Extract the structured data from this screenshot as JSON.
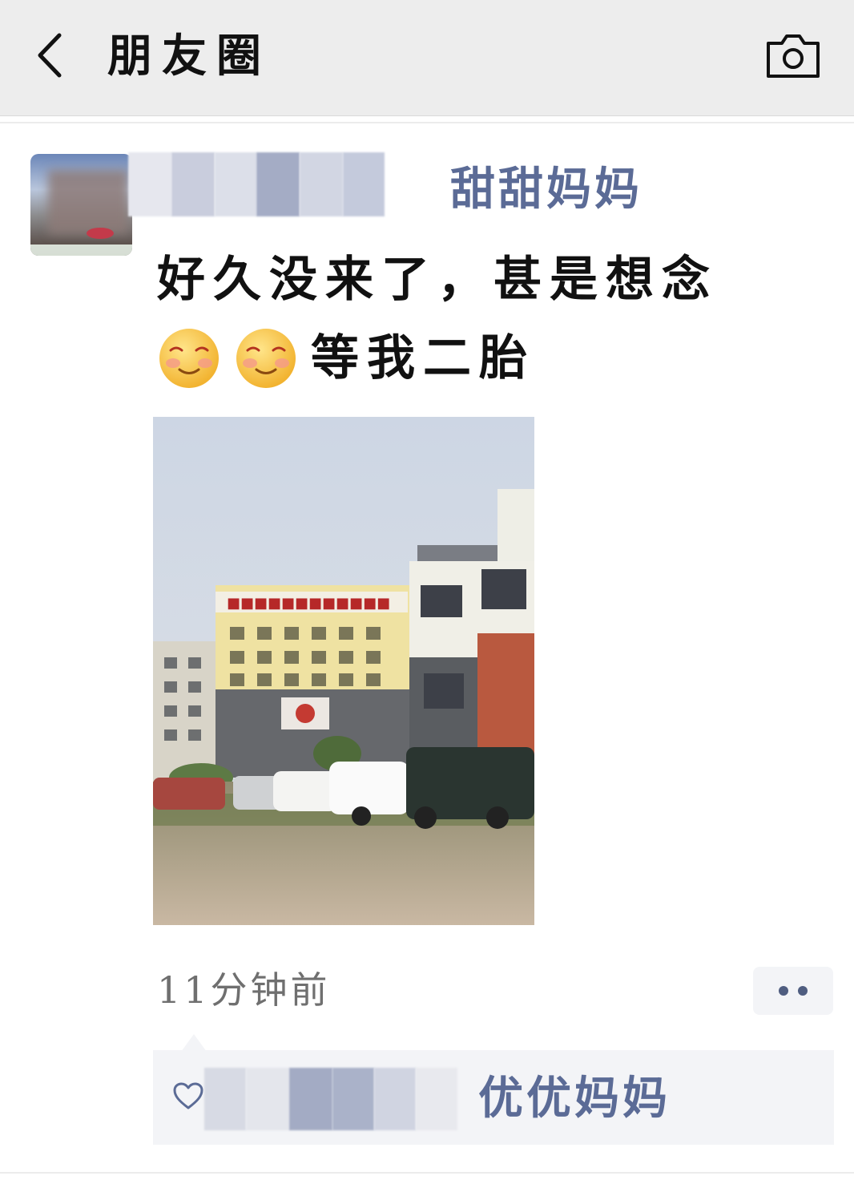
{
  "header": {
    "title": "朋友圈",
    "back_icon": "chevron-left-icon",
    "camera_icon": "camera-icon",
    "background": "#ededed"
  },
  "post": {
    "nickname": "甜甜妈妈",
    "text_line1": "好久没来了，甚是想念",
    "text_line2": "等我二胎",
    "emoji": "blushing-smile-emoji",
    "emoji_count": 2,
    "time": "11分钟前",
    "more_icon": "more-dots-icon",
    "name_color": "#5b6b96"
  },
  "likes": {
    "icon": "heart-icon",
    "names": [
      "优优妈妈"
    ]
  }
}
